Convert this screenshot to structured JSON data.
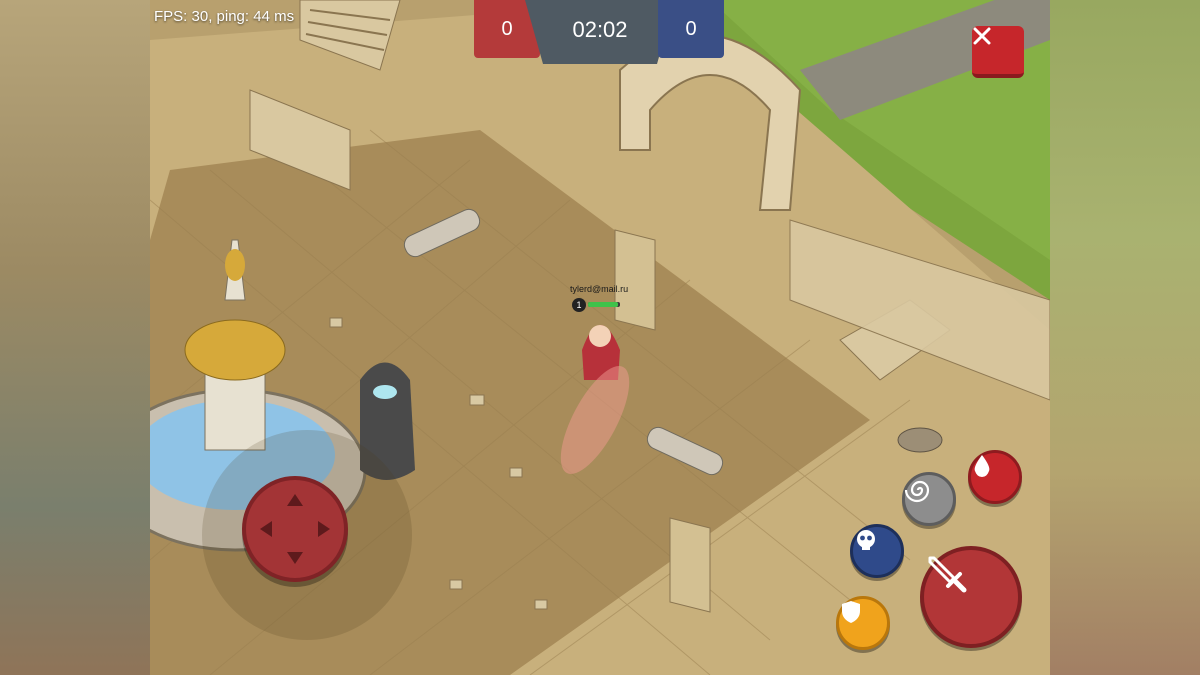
{
  "hud": {
    "fps_text": "FPS: 30, ping: 44 ms",
    "score_red": "0",
    "score_blue": "0",
    "timer": "02:02",
    "close_label": "×"
  },
  "player": {
    "name": "tylerd@mail.ru",
    "level": "1",
    "health": 0.95
  },
  "colors": {
    "red_team": "#b43a3a",
    "blue_team": "#3a4f86",
    "attack_button": "#b23637",
    "potion_button": "#c6262b",
    "shield_button": "#f0a31c",
    "skull_button": "#2f4a8a",
    "swirl_button": "#8a8a8a"
  },
  "controls": {
    "joystick": "dpad-joystick",
    "attack_icon": "sword-icon",
    "potion_icon": "blood-drop-icon",
    "swirl_icon": "swirl-icon",
    "skull_icon": "skull-icon",
    "shield_icon": "shield-icon"
  }
}
